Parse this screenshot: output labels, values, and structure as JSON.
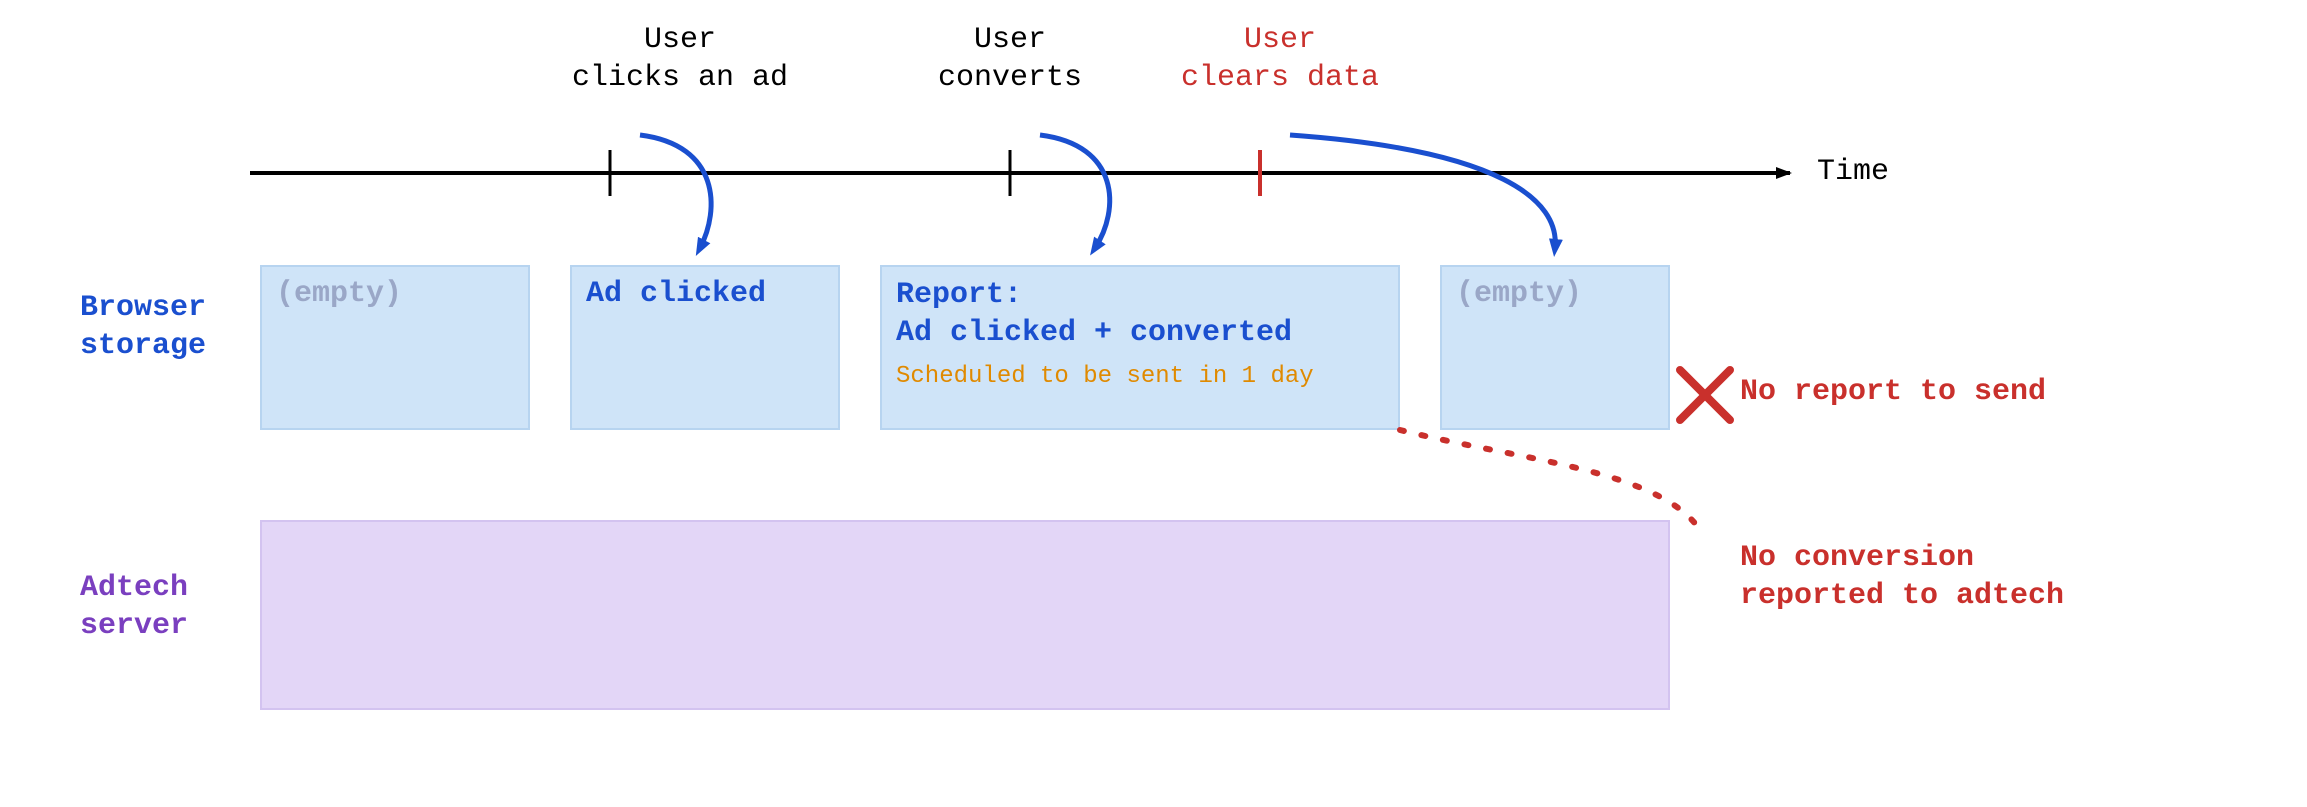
{
  "axis": {
    "label": "Time"
  },
  "events": {
    "click": {
      "line1": "User",
      "line2": "clicks an ad"
    },
    "convert": {
      "line1": "User",
      "line2": "converts"
    },
    "clear": {
      "line1": "User",
      "line2": "clears data"
    }
  },
  "rows": {
    "browser": {
      "line1": "Browser",
      "line2": "storage"
    },
    "adtech": {
      "line1": "Adtech",
      "line2": "server"
    }
  },
  "storage": {
    "empty1": "(empty)",
    "adclicked": "Ad clicked",
    "report_title": "Report:",
    "report_body": "Ad clicked + converted",
    "report_note": "Scheduled to be sent in 1 day",
    "empty2": "(empty)"
  },
  "errors": {
    "no_report": "No report to send",
    "no_conv1": "No conversion",
    "no_conv2": "reported to adtech"
  }
}
